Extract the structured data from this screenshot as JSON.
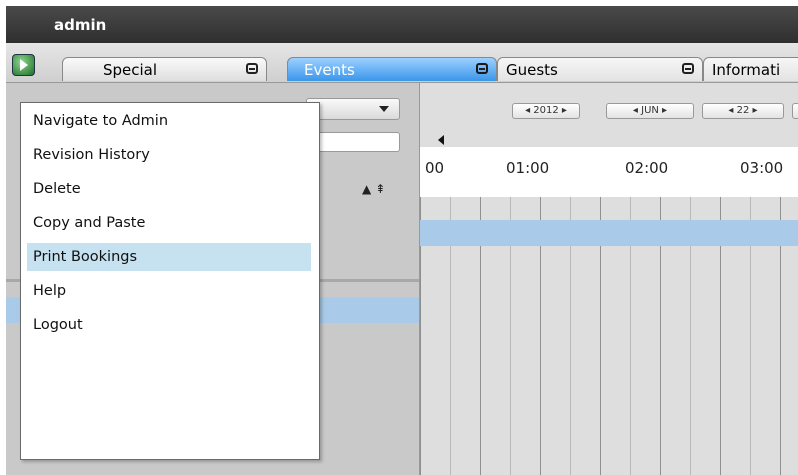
{
  "title": "admin",
  "tabs": [
    {
      "label": "Special"
    },
    {
      "label": "Events"
    },
    {
      "label": "Guests"
    },
    {
      "label": "Informati"
    }
  ],
  "menu": {
    "items": [
      {
        "label": "Navigate to Admin"
      },
      {
        "label": "Revision History"
      },
      {
        "label": "Delete"
      },
      {
        "label": "Copy and Paste"
      },
      {
        "label": "Print Bookings",
        "highlighted": true
      },
      {
        "label": "Help"
      },
      {
        "label": "Logout"
      }
    ]
  },
  "date_nav": {
    "year": "2012",
    "month": "JUN",
    "day": "22"
  },
  "timeline": {
    "hours": [
      "00",
      "01:00",
      "02:00",
      "03:00"
    ]
  },
  "colors": {
    "active_tab": "#3a95ea",
    "highlight_row": "#a9cbe9",
    "menu_highlight": "#c6e1ef"
  },
  "icons": {
    "logo": "play-circle-icon",
    "tab_control": "minus-box-icon",
    "sort": "sort-up-icons"
  }
}
